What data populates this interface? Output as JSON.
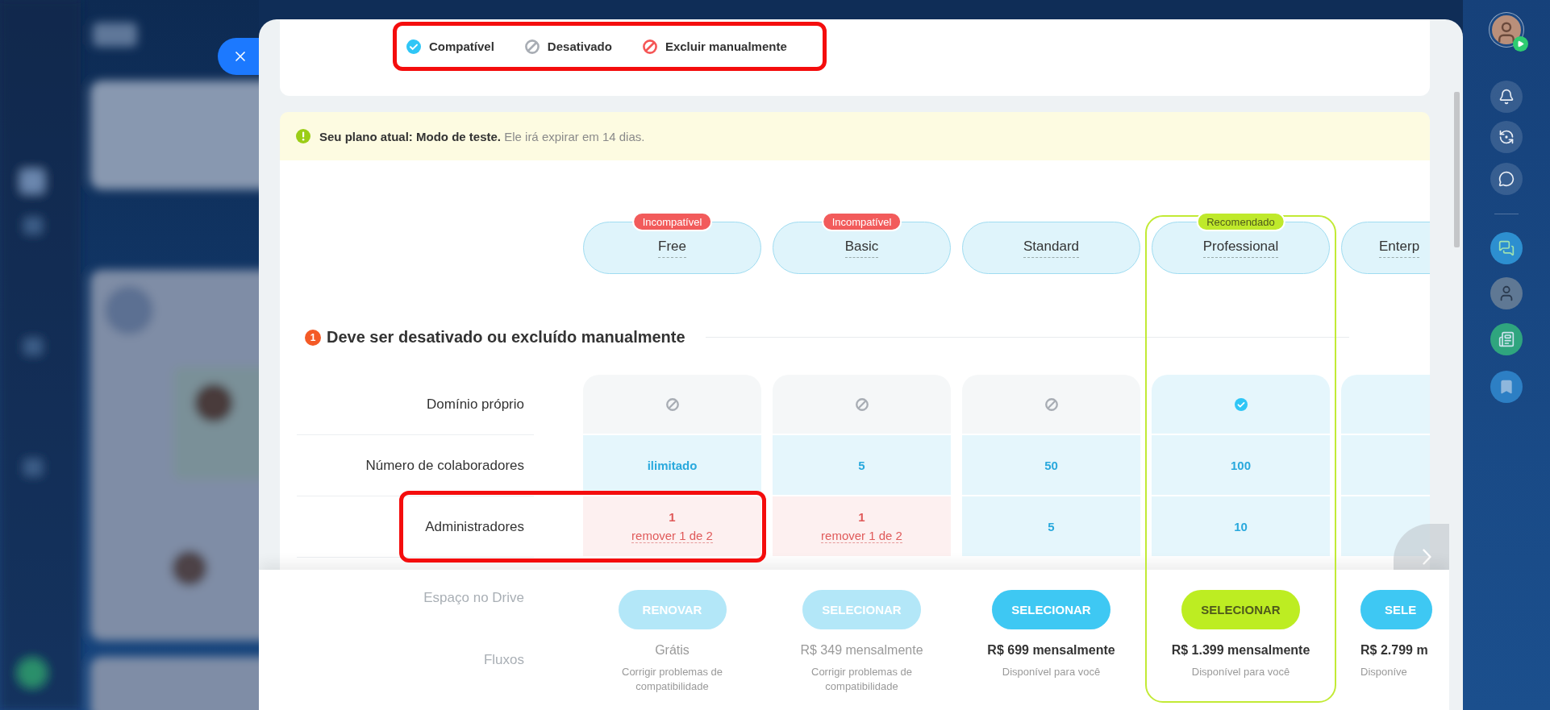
{
  "legend": {
    "highlighted": true,
    "items": [
      {
        "kind": "compatible",
        "label": "Compatível"
      },
      {
        "kind": "disabled",
        "label": "Desativado"
      },
      {
        "kind": "exclude",
        "label": "Excluir manualmente"
      }
    ]
  },
  "banner": {
    "text": "**Seu plano atual: Modo de teste.** Ele irá expirar em 14 dias."
  },
  "plans": [
    {
      "name": "Free",
      "clipped": false,
      "badge": {
        "kind": "incompatible",
        "text": "Incompatível"
      }
    },
    {
      "name": "Basic",
      "clipped": false,
      "badge": {
        "kind": "incompatible",
        "text": "Incompatível"
      }
    },
    {
      "name": "Standard",
      "clipped": false
    },
    {
      "name": "Professional",
      "clipped": false,
      "badge": {
        "kind": "recommended",
        "text": "Recomendado"
      }
    },
    {
      "name": "Enterp",
      "clipped": true
    }
  ],
  "section": {
    "number": "1",
    "title": "Deve ser desativado ou excluído manualmente"
  },
  "rows": [
    {
      "label": "Domínio próprio",
      "highlighted": false,
      "cells": [
        {
          "kind": "disabled"
        },
        {
          "kind": "disabled"
        },
        {
          "kind": "disabled"
        },
        {
          "kind": "compatible"
        },
        {
          "kind": "blank"
        }
      ]
    },
    {
      "label": "Número de colaboradores",
      "highlighted": false,
      "cells": [
        {
          "kind": "value",
          "text": "ilimitado"
        },
        {
          "kind": "value",
          "text": "5"
        },
        {
          "kind": "value",
          "text": "50"
        },
        {
          "kind": "value",
          "text": "100"
        },
        {
          "kind": "blank"
        }
      ]
    },
    {
      "label": "Administradores",
      "highlighted": true,
      "cells": [
        {
          "kind": "problem",
          "value": "1",
          "action": "remover 1 de 2"
        },
        {
          "kind": "problem",
          "value": "1",
          "action": "remover 1 de 2"
        },
        {
          "kind": "value",
          "text": "5"
        },
        {
          "kind": "value",
          "text": "10"
        },
        {
          "kind": "blank"
        }
      ]
    }
  ],
  "faded_labels": [
    "Espaço no Drive",
    "Fluxos"
  ],
  "footer": [
    {
      "button": "RENOVAR",
      "disabled": true,
      "price": "Grátis",
      "note": "Corrigir problemas de compatibilidade"
    },
    {
      "button": "SELECIONAR",
      "disabled": true,
      "price": "R$ 349 mensalmente",
      "note": "Corrigir problemas de compatibilidade"
    },
    {
      "button": "SELECIONAR",
      "disabled": false,
      "price": "R$ 699 mensalmente",
      "note": "Disponível para você"
    },
    {
      "button": "SELECIONAR",
      "disabled": false,
      "price": "R$ 1.399 mensalmente",
      "note": "Disponível para você"
    },
    {
      "button": "SELE",
      "disabled": false,
      "price": "R$ 2.799 m",
      "note": "Disponíve"
    }
  ]
}
